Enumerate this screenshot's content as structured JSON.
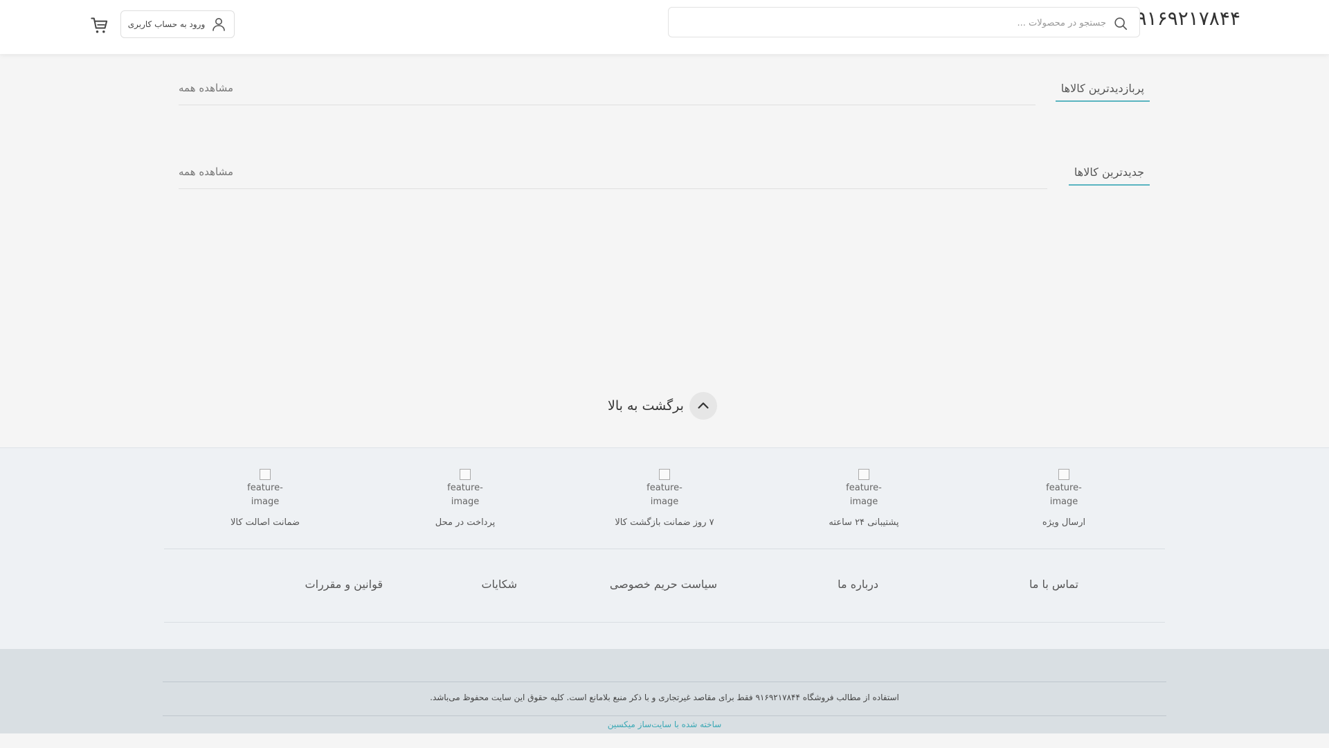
{
  "header": {
    "logo": "۹۱۶۹۲۱۷۸۴۴",
    "search_placeholder": "جستجو در محصولات ...",
    "login_label": "ورود به حساب کاربری"
  },
  "sections": [
    {
      "title": "پربازدیدترین کالاها",
      "view_all": "مشاهده همه"
    },
    {
      "title": "جدیدترین کالاها",
      "view_all": "مشاهده همه"
    }
  ],
  "back_to_top": "برگشت به بالا",
  "features": [
    {
      "img_alt": "feature-image",
      "label": "ارسال ویژه"
    },
    {
      "img_alt": "feature-image",
      "label": "پشتیبانی ۲۴ ساعته"
    },
    {
      "img_alt": "feature-image",
      "label": "۷ روز ضمانت بازگشت کالا"
    },
    {
      "img_alt": "feature-image",
      "label": "پرداخت در محل"
    },
    {
      "img_alt": "feature-image",
      "label": "ضمانت اصالت کالا"
    }
  ],
  "footer_links": [
    "تماس با ما",
    "درباره ما",
    "سیاست حریم خصوصی",
    "شکایات",
    "قوانین و مقررات"
  ],
  "copyright": "استفاده از مطالب فروشگاه ۹۱۶۹۲۱۷۸۴۴ فقط برای مقاصد غیرتجاری و با ذکر منبع بلامانع است. کلیه حقوق این سایت محفوظ می‌باشد.",
  "built_by": "ساخته شده با سایت‌ساز میکسین",
  "colors": {
    "accent": "#5ab4c0",
    "link": "#3aa8b5",
    "footer_bg": "#eef1f4",
    "copyright_bg": "#d9dfe3"
  }
}
